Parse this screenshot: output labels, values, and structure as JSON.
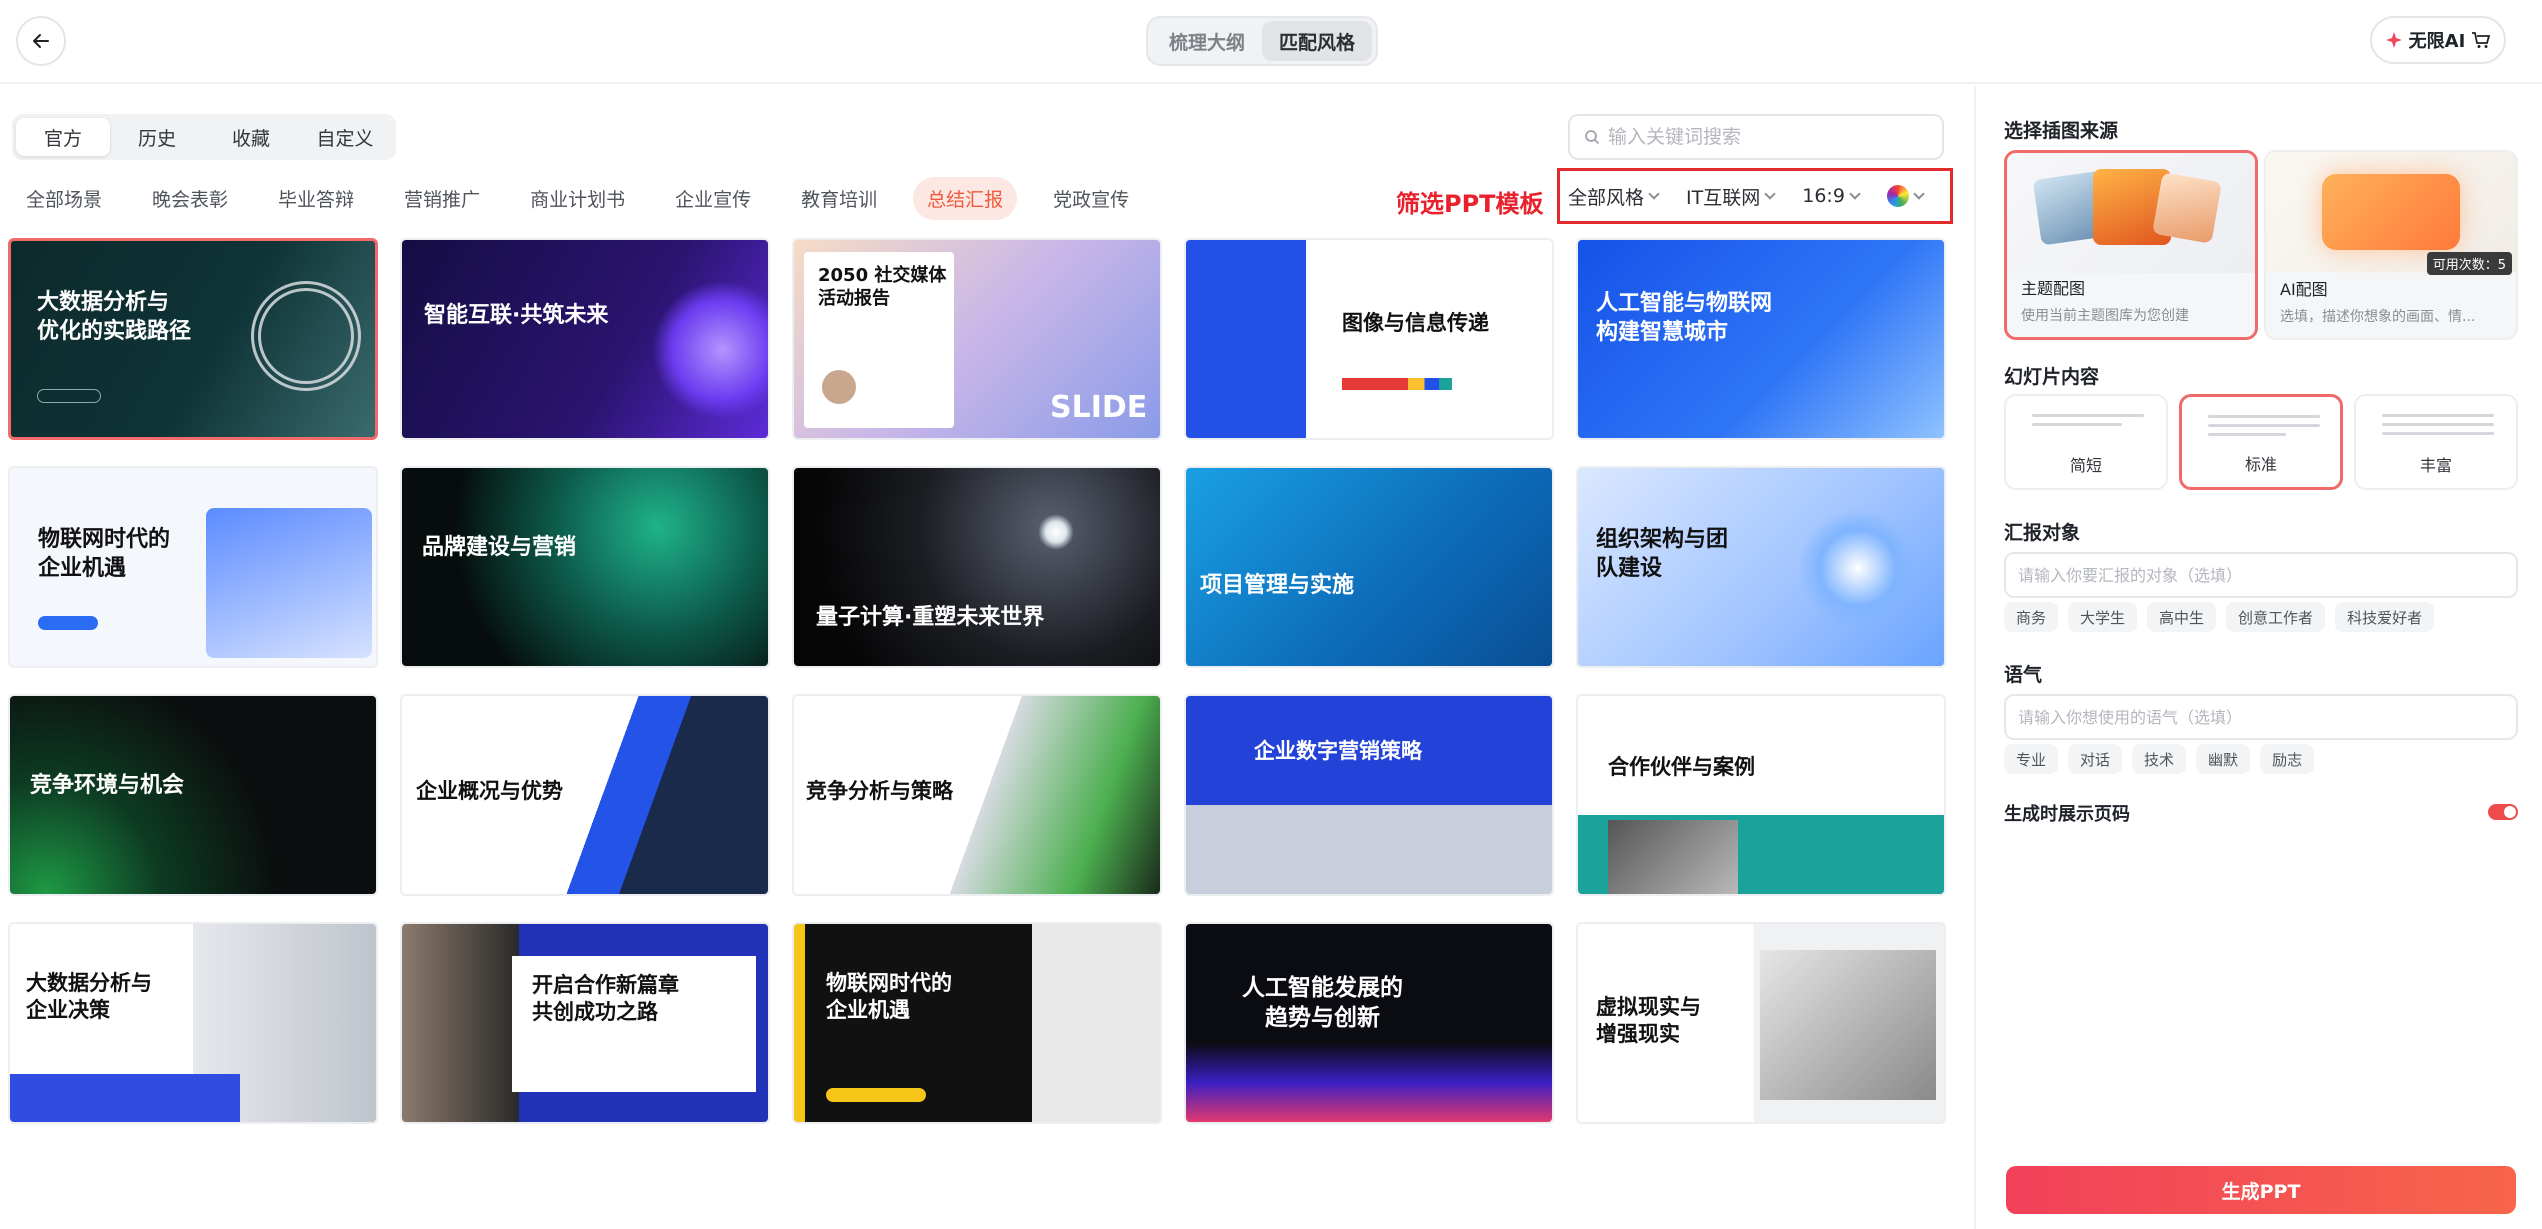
{
  "header": {
    "steps": [
      "梳理大纲",
      "匹配风格"
    ],
    "active_step": "匹配风格",
    "vip_label": "无限AI"
  },
  "source_tabs": [
    "官方",
    "历史",
    "收藏",
    "自定义"
  ],
  "search": {
    "placeholder": "输入关键词搜索"
  },
  "categories": [
    "全部场景",
    "晚会表彰",
    "毕业答辩",
    "营销推广",
    "商业计划书",
    "企业宣传",
    "教育培训",
    "总结汇报",
    "党政宣传"
  ],
  "active_category": "总结汇报",
  "filter": {
    "annotation": "筛选PPT模板",
    "style": "全部风格",
    "industry": "IT互联网",
    "ratio": "16:9"
  },
  "templates": [
    {
      "title": "大数据分析与\n优化的实践路径"
    },
    {
      "title": "智能互联·共筑未来"
    },
    {
      "title": "2050 社交媒体\n活动报告",
      "badge": "SLIDE"
    },
    {
      "title": "图像与信息传递"
    },
    {
      "title": "人工智能与物联网\n构建智慧城市"
    },
    {
      "title": "物联网时代的\n企业机遇"
    },
    {
      "title": "品牌建设与营销"
    },
    {
      "title": "量子计算·重塑未来世界"
    },
    {
      "title": "项目管理与实施"
    },
    {
      "title": "组织架构与团\n队建设"
    },
    {
      "title": "竞争环境与机会"
    },
    {
      "title": "企业概况与优势"
    },
    {
      "title": "竞争分析与策略"
    },
    {
      "title": "企业数字营销策略"
    },
    {
      "title": "合作伙伴与案例"
    },
    {
      "title": "大数据分析与\n企业决策"
    },
    {
      "title": "开启合作新篇章\n共创成功之路"
    },
    {
      "title": "物联网时代的\n企业机遇"
    },
    {
      "title": "人工智能发展的\n趋势与创新"
    },
    {
      "title": "虚拟现实与\n增强现实"
    }
  ],
  "sidebar": {
    "illustration_title": "选择插图来源",
    "illustration_options": [
      {
        "label": "主题配图",
        "desc": "使用当前主题图库为您创建"
      },
      {
        "label": "AI配图",
        "desc": "选填，描述你想象的画面、情...",
        "badge": "可用次数：5"
      }
    ],
    "content_title": "幻灯片内容",
    "content_options": [
      "简短",
      "标准",
      "丰富"
    ],
    "content_selected": "标准",
    "audience_title": "汇报对象",
    "audience_placeholder": "请输入你要汇报的对象（选填）",
    "audience_chips": [
      "商务",
      "大学生",
      "高中生",
      "创意工作者",
      "科技爱好者"
    ],
    "tone_title": "语气",
    "tone_placeholder": "请输入你想使用的语气（选填）",
    "tone_chips": [
      "专业",
      "对话",
      "技术",
      "幽默",
      "励志"
    ],
    "page_number_label": "生成时展示页码",
    "page_number_on": true,
    "generate_label": "生成PPT"
  }
}
